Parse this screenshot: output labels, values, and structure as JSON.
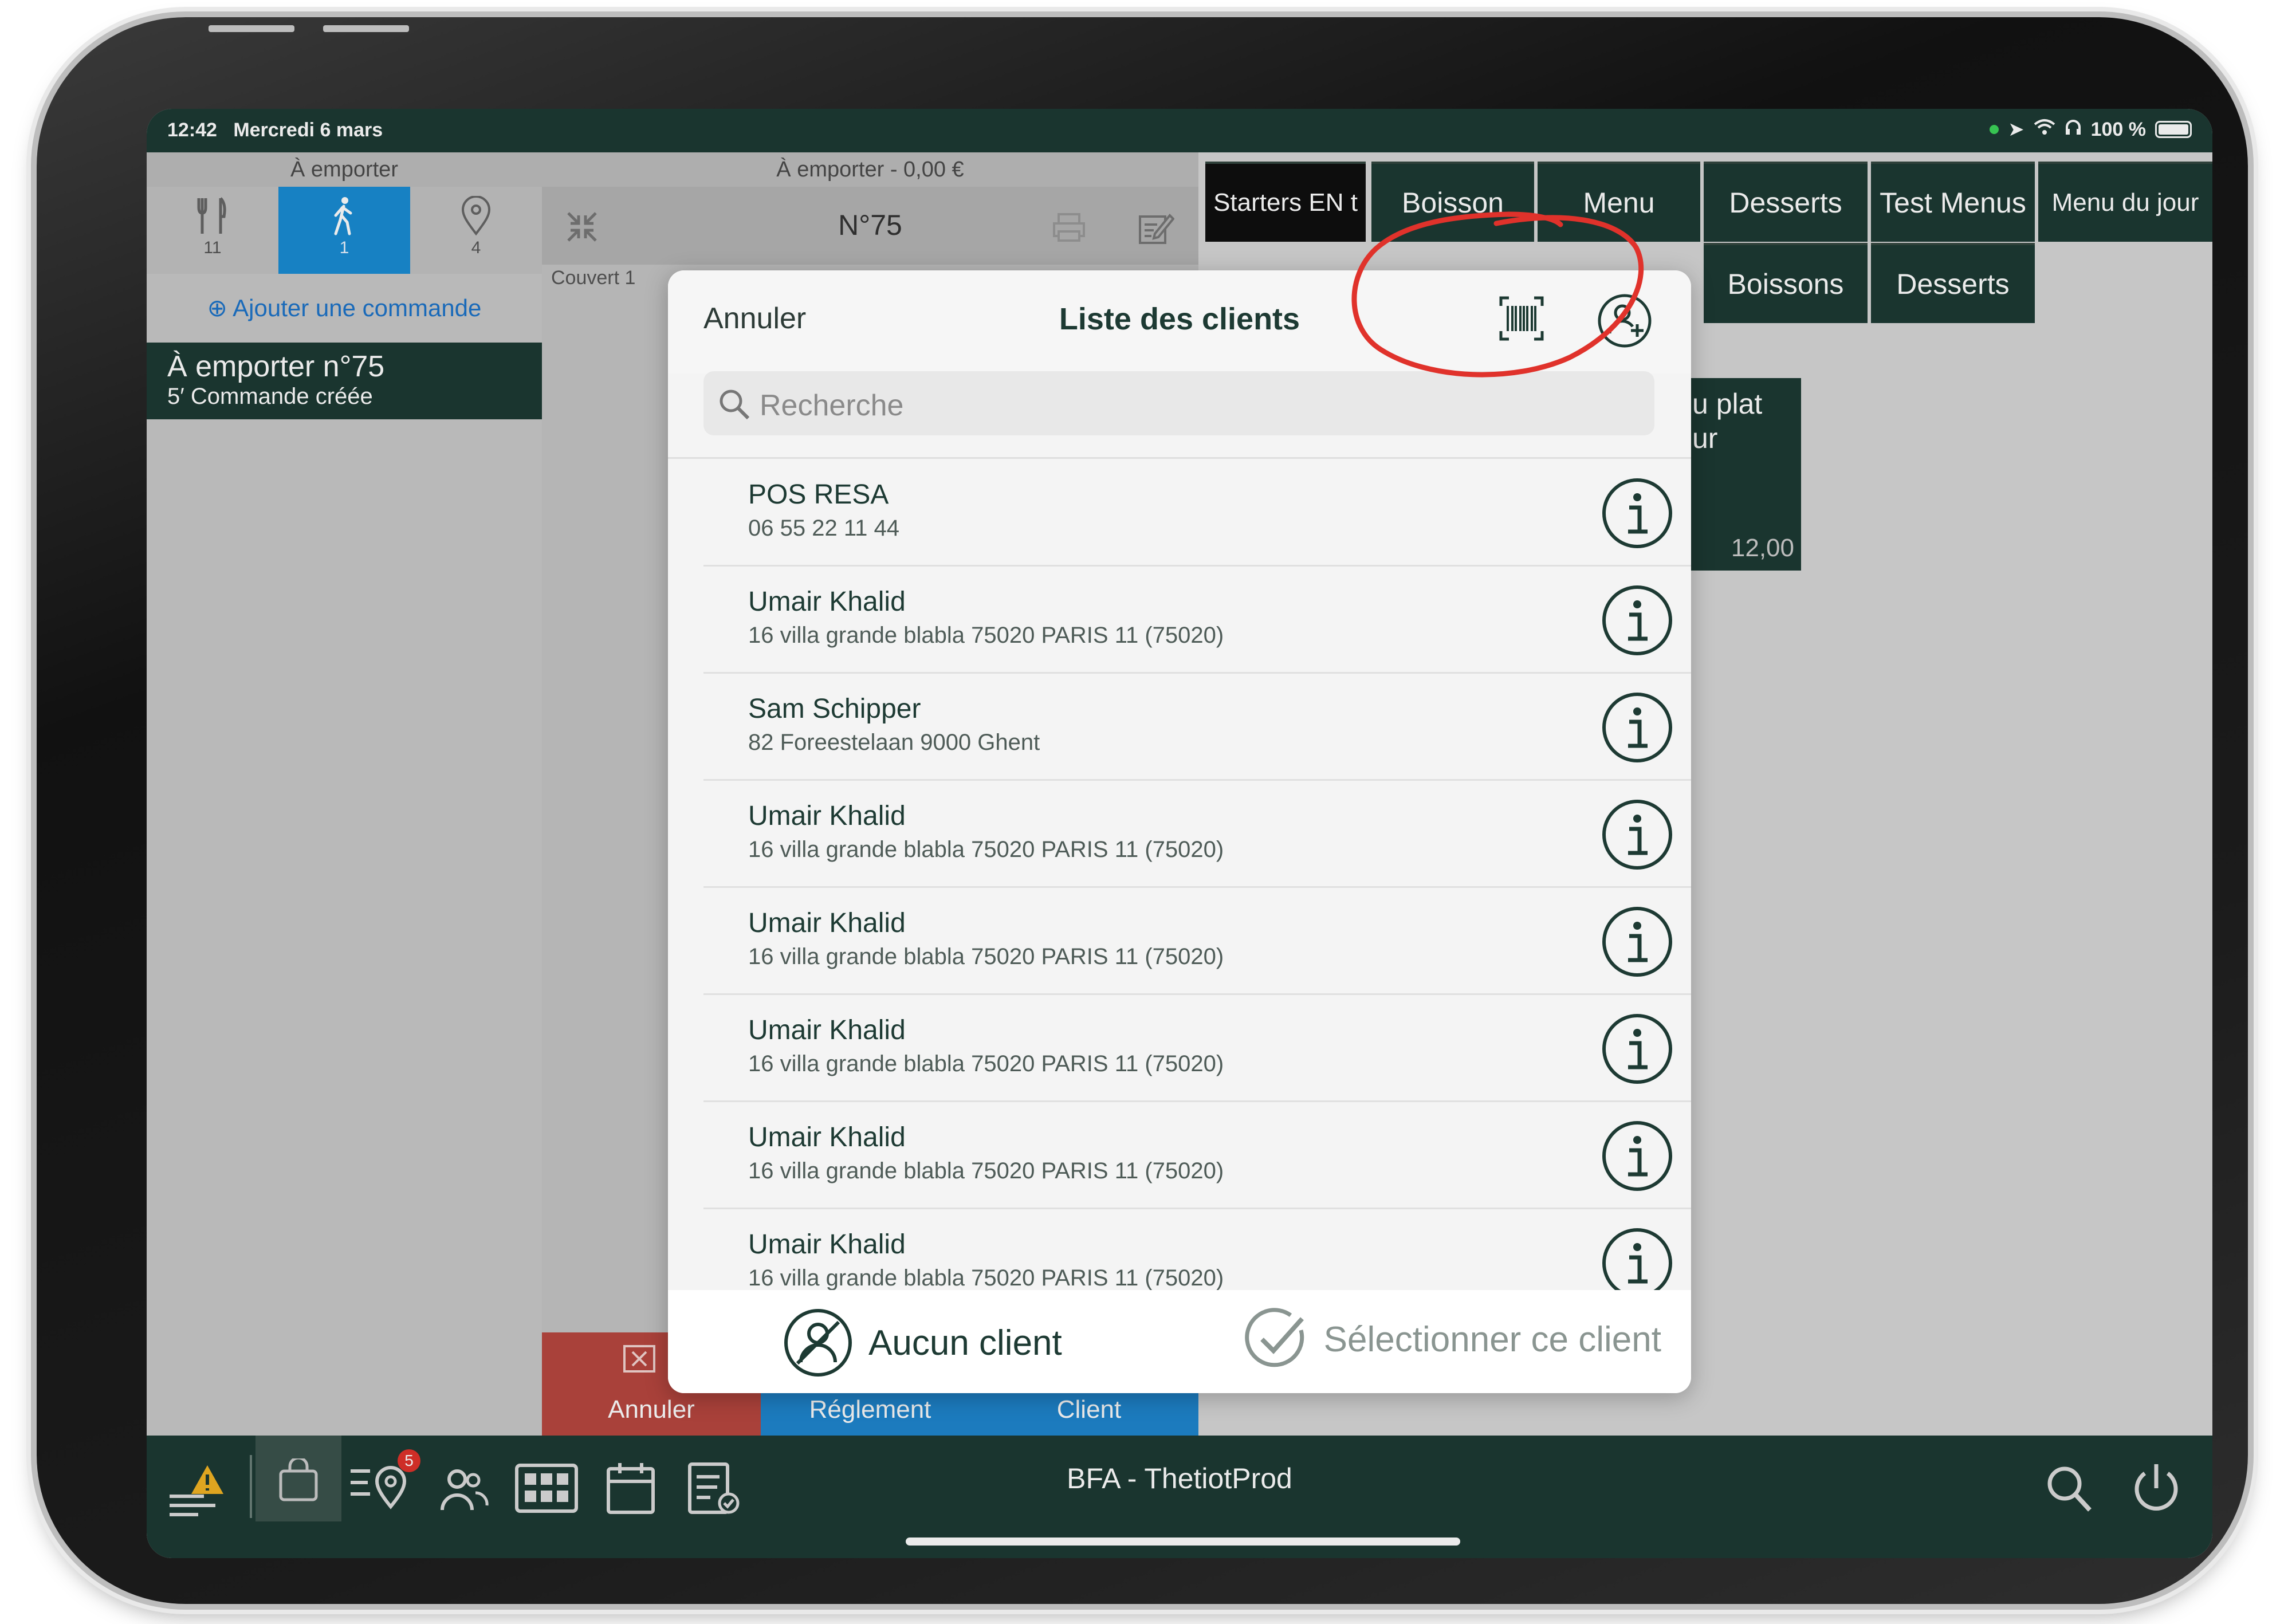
{
  "status": {
    "time": "12:42",
    "date": "Mercredi 6 mars",
    "battery": "100 %"
  },
  "left": {
    "header": "À emporter",
    "modes": [
      {
        "icon": "fork-knife-icon",
        "count": "11"
      },
      {
        "icon": "walking-person-icon",
        "count": "1"
      },
      {
        "icon": "map-pin-icon",
        "count": "4"
      }
    ],
    "add_order": "Ajouter une commande",
    "order": {
      "title": "À emporter n°75",
      "subtitle": "5′ Commande créée"
    }
  },
  "middle": {
    "header": "À emporter - 0,00 €",
    "number": "N°75",
    "cover": "Couvert 1",
    "buttons": {
      "cancel": "Annuler",
      "payment": "Réglement",
      "client": "Client"
    }
  },
  "categories": {
    "row1": [
      "Starters EN t",
      "Boisson",
      "Menu",
      "Desserts",
      "Test Menus",
      "Menu du jour"
    ],
    "row2": [
      "Boissons",
      "Desserts"
    ],
    "product": {
      "line1": "u plat",
      "line2": "ur",
      "price": "12,00"
    }
  },
  "bottom_nav": {
    "title": "BFA - ThetiotProd",
    "badge": "5"
  },
  "modal": {
    "cancel": "Annuler",
    "title": "Liste des clients",
    "search_placeholder": "Recherche",
    "clients": [
      {
        "name": "POS RESA",
        "detail": "06 55 22 11 44"
      },
      {
        "name": "Umair Khalid",
        "detail": "16 villa grande blabla 75020 PARIS 11 (75020)"
      },
      {
        "name": "Sam Schipper",
        "detail": "82 Foreestelaan 9000 Ghent"
      },
      {
        "name": "Umair Khalid",
        "detail": "16 villa grande blabla 75020 PARIS 11 (75020)"
      },
      {
        "name": "Umair Khalid",
        "detail": "16 villa grande blabla 75020 PARIS 11 (75020)"
      },
      {
        "name": "Umair Khalid",
        "detail": "16 villa grande blabla 75020 PARIS 11 (75020)"
      },
      {
        "name": "Umair Khalid",
        "detail": "16 villa grande blabla 75020 PARIS 11 (75020)"
      },
      {
        "name": "Umair Khalid",
        "detail": "16 villa grande blabla 75020 PARIS 11 (75020)"
      }
    ],
    "no_client": "Aucun client",
    "select_client": "Sélectionner ce client"
  },
  "colors": {
    "dark_green": "#1d3a33",
    "blue": "#1a8dd4",
    "cancel_red": "#b8473f",
    "annotation": "#e0322b"
  }
}
